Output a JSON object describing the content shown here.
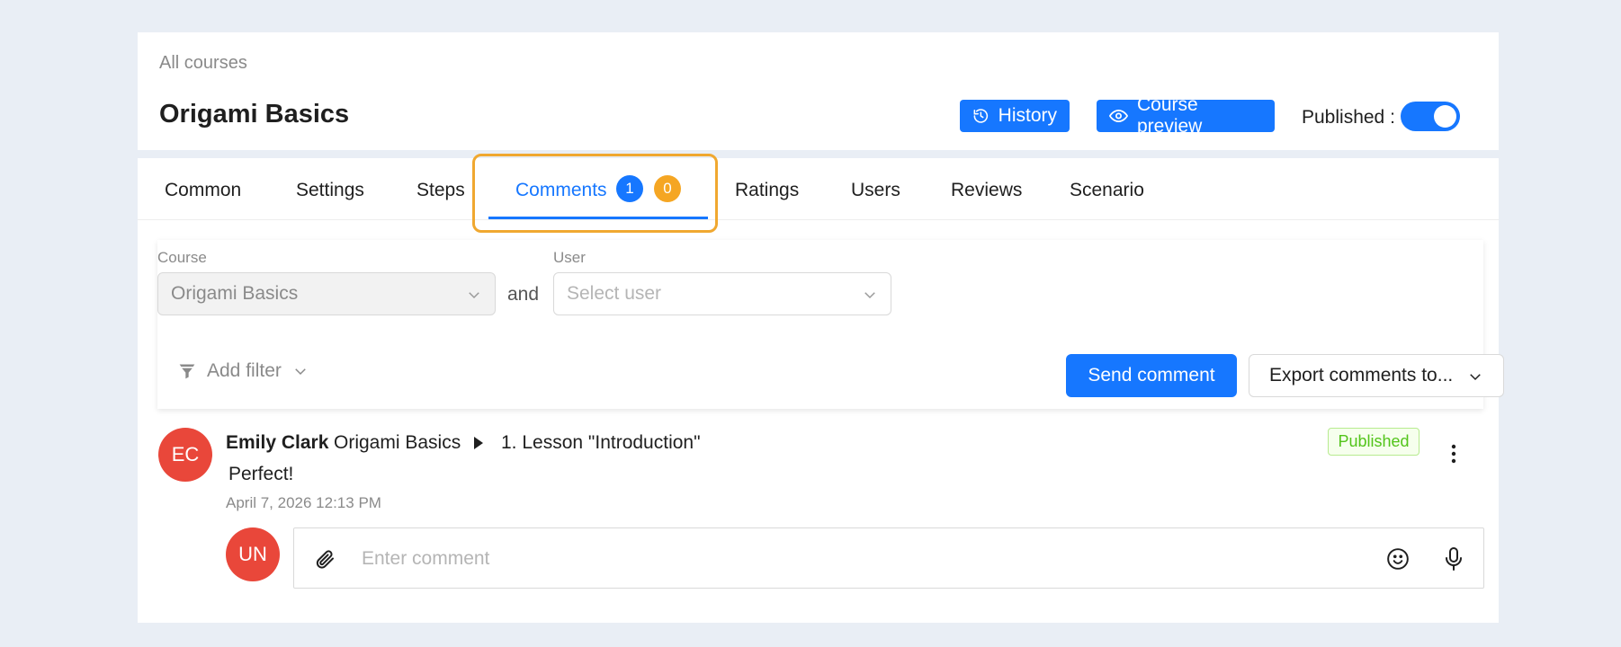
{
  "header": {
    "breadcrumb": "All courses",
    "title": "Origami Basics",
    "history_label": "History",
    "preview_label": "Course preview",
    "published_label": "Published :"
  },
  "tabs": [
    {
      "label": "Common"
    },
    {
      "label": "Settings"
    },
    {
      "label": "Steps"
    },
    {
      "label": "Comments",
      "badges": [
        "1",
        "0"
      ]
    },
    {
      "label": "Ratings"
    },
    {
      "label": "Users"
    },
    {
      "label": "Reviews"
    },
    {
      "label": "Scenario"
    }
  ],
  "filters": {
    "course_label": "Course",
    "course_value": "Origami Basics",
    "and_text": "and",
    "user_label": "User",
    "user_placeholder": "Select user",
    "add_filter_label": "Add filter",
    "send_comment_label": "Send comment",
    "export_label": "Export comments to..."
  },
  "comment": {
    "avatar_initials": "EC",
    "author": "Emily Clark",
    "course": "Origami Basics",
    "lesson": "1. Lesson \"Introduction\"",
    "text": "Perfect!",
    "timestamp": "April 7, 2026 12:13 PM",
    "status": "Published"
  },
  "reply": {
    "avatar_initials": "UN",
    "placeholder": "Enter comment"
  },
  "colors": {
    "primary": "#1677ff",
    "badge_orange": "#f5a623",
    "avatar_red": "#e9473a",
    "highlight": "#f0a830",
    "success": "#52c41a"
  }
}
